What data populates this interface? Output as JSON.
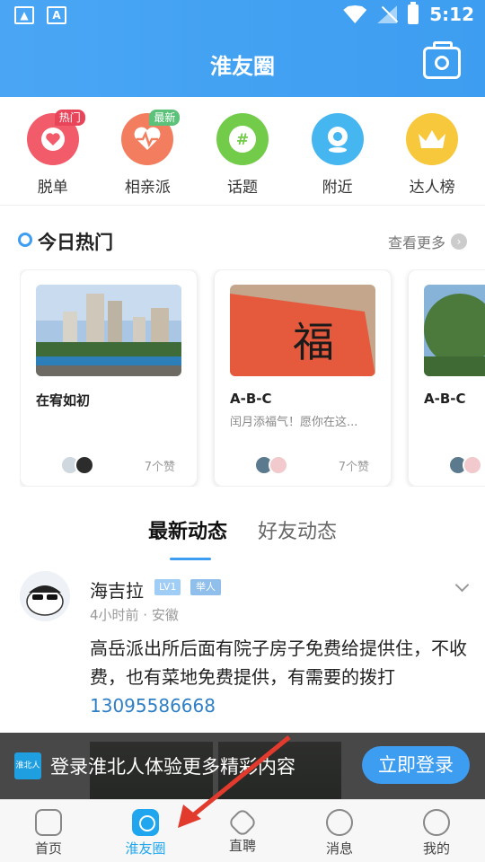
{
  "status_bar": {
    "time": "5:12"
  },
  "header": {
    "title": "淮友圈"
  },
  "categories": [
    {
      "label": "脱单",
      "badge": "热门",
      "color": "#f25b6a",
      "badge_color": "#e8455a",
      "glyph": "♥"
    },
    {
      "label": "相亲派",
      "badge": "最新",
      "color": "#f27e5f",
      "badge_color": "#5cc27a",
      "glyph": "♥"
    },
    {
      "label": "话题",
      "badge": "",
      "color": "#72cc49",
      "badge_color": "",
      "glyph": "#"
    },
    {
      "label": "附近",
      "badge": "",
      "color": "#45b6f0",
      "badge_color": "",
      "glyph": "◉"
    },
    {
      "label": "达人榜",
      "badge": "",
      "color": "#f7c73c",
      "badge_color": "",
      "glyph": "♛"
    }
  ],
  "hot": {
    "title": "今日热门",
    "more_label": "查看更多",
    "cards": [
      {
        "title": "在宥如初",
        "desc": "",
        "likes": "7个赞"
      },
      {
        "title": "A-B-C",
        "desc": "闰月添福气！愿你在这...",
        "likes": "7个赞"
      },
      {
        "title": "A-B-C",
        "desc": "",
        "likes": ""
      }
    ]
  },
  "feed_tabs": {
    "latest": "最新动态",
    "friends": "好友动态"
  },
  "post": {
    "name": "海吉拉",
    "level": "LV1",
    "role": "举人",
    "meta": "4小时前 · 安徽",
    "text": "高岳派出所后面有院子房子免费给提供住，不收费，也有菜地免费提供，有需要的拨打",
    "phone": "13095586668"
  },
  "login_banner": {
    "logo_text": "淮北人",
    "text": "登录淮北人体验更多精彩内容",
    "button": "立即登录"
  },
  "nav": {
    "home": "首页",
    "circle": "淮友圈",
    "jobs": "直聘",
    "messages": "消息",
    "mine": "我的"
  },
  "colors": {
    "primary": "#3d9df0",
    "active_nav": "#1fa6ef"
  }
}
